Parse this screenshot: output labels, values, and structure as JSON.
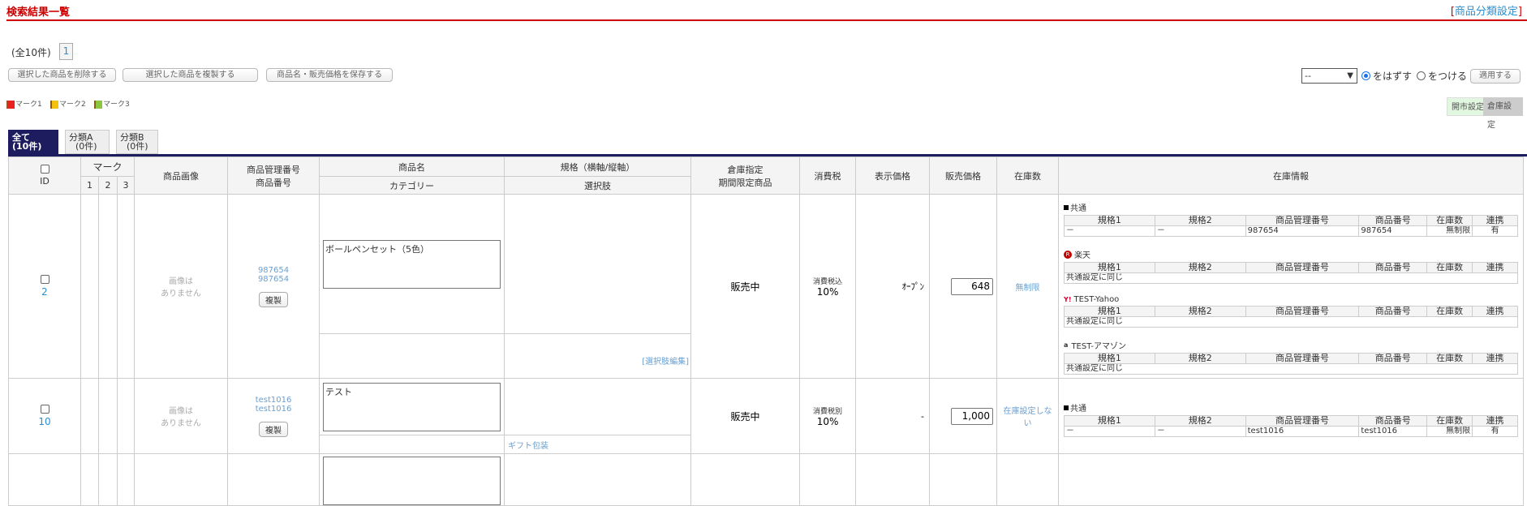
{
  "header": {
    "title": "検索結果一覧",
    "category_link": "商品分類設定",
    "bracket_open": "[",
    "bracket_close": "]"
  },
  "pager": {
    "count": "(全10件)",
    "page": "1"
  },
  "actions": {
    "delete": "選択した商品を削除する",
    "duplicate": "選択した商品を複製する",
    "save": "商品名・販売価格を保存する"
  },
  "marks": [
    {
      "label": "マーク1",
      "color": "#e8231f"
    },
    {
      "label": "マーク2",
      "color": "#f4c20d"
    },
    {
      "label": "マーク3",
      "color": "#8cc63f"
    }
  ],
  "mark_control": {
    "select_value": "--",
    "radio_remove": "をはずす",
    "radio_add": "をつける",
    "apply": "適用する"
  },
  "toggle": {
    "market": "開市設定",
    "warehouse": "倉庫設定"
  },
  "tabs": [
    {
      "l1": "全て",
      "l2": "(10件)"
    },
    {
      "l1": "分類A",
      "l2": "(0件)"
    },
    {
      "l1": "分類B",
      "l2": "(0件)"
    }
  ],
  "columns": {
    "id": "ID",
    "mark": "マーク",
    "m1": "1",
    "m2": "2",
    "m3": "3",
    "image": "商品画像",
    "code1": "商品管理番号",
    "code2": "商品番号",
    "name": "商品名",
    "category": "カテゴリー",
    "spec": "規格（横軸/縦軸）",
    "option": "選択肢",
    "store1": "倉庫指定",
    "store2": "期間限定商品",
    "tax": "消費税",
    "display_price": "表示価格",
    "sale_price": "販売価格",
    "stock": "在庫数",
    "stock_info": "在庫情報"
  },
  "sub_headers": [
    "規格1",
    "規格2",
    "商品管理番号",
    "商品番号",
    "在庫数",
    "連携"
  ],
  "rows": [
    {
      "id": "2",
      "no_image1": "画像は",
      "no_image2": "ありません",
      "code1": "987654",
      "code2": "987654",
      "copy": "複製",
      "name": "ボールペンセット（5色）",
      "category": "",
      "option_link": "[選択肢編集]",
      "status": "販売中",
      "tax_type": "消費税込",
      "tax_rate": "10%",
      "display_price": "ｵｰﾌﾟﾝ",
      "sale_price": "648",
      "stock": "無制限",
      "blocks": [
        {
          "name": "共通",
          "icon": "square",
          "cells": [
            "－",
            "－",
            "987654",
            "987654",
            "無制限",
            "有"
          ]
        },
        {
          "name": "楽天",
          "icon": "rakuten",
          "same": "共通設定に同じ"
        },
        {
          "name": "TEST-Yahoo",
          "icon": "yahoo",
          "same": "共通設定に同じ"
        },
        {
          "name": "TEST-アマゾン",
          "icon": "amazon",
          "same": "共通設定に同じ"
        }
      ]
    },
    {
      "id": "10",
      "no_image1": "画像は",
      "no_image2": "ありません",
      "code1": "test1016",
      "code2": "test1016",
      "copy": "複製",
      "name": "テスト",
      "category": "",
      "option_link": "ギフト包装",
      "status": "販売中",
      "tax_type": "消費税別",
      "tax_rate": "10%",
      "display_price": "-",
      "sale_price": "1,000",
      "stock": "在庫設定しない",
      "blocks": [
        {
          "name": "共通",
          "icon": "square",
          "cells": [
            "－",
            "－",
            "test1016",
            "test1016",
            "無制限",
            "有"
          ]
        }
      ]
    }
  ]
}
